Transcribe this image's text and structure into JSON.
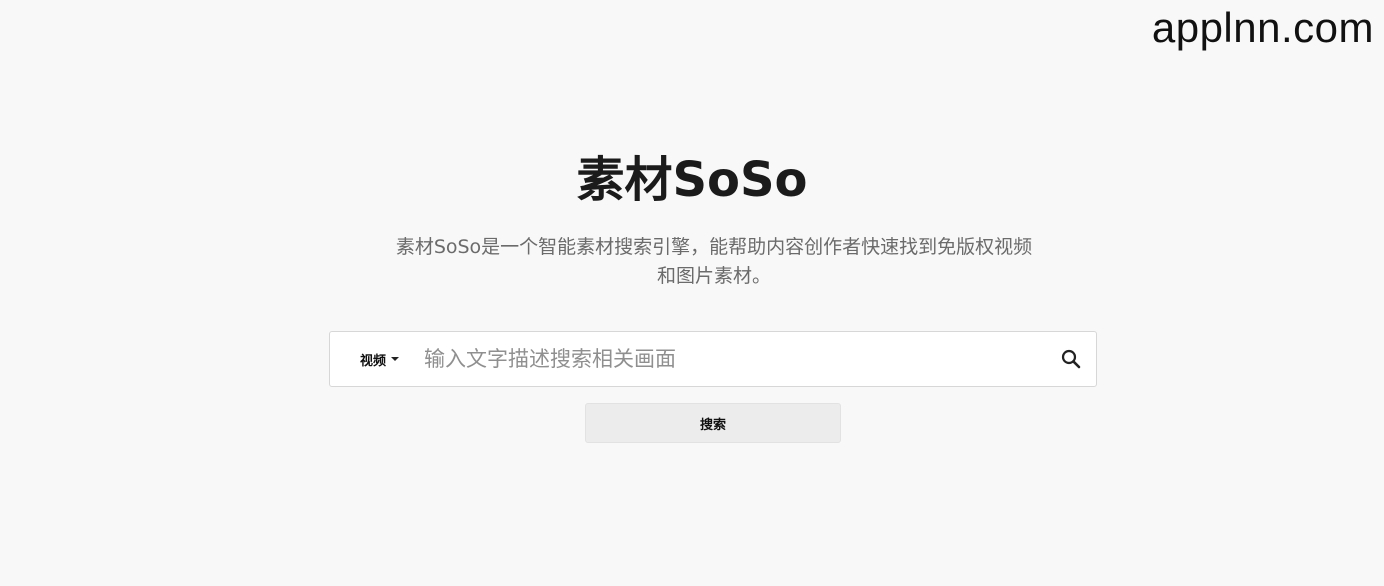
{
  "watermark": "applnn.com",
  "hero": {
    "title": "素材SoSo",
    "description_line1": "素材SoSo是一个智能素材搜索引擎，能帮助内容创作者快速找到免版权视频",
    "description_line2": "和图片素材。"
  },
  "search": {
    "type_selected": "视频",
    "placeholder": "输入文字描述搜索相关画面",
    "value": "",
    "button_label": "搜索"
  },
  "icons": {
    "search": "search-icon",
    "caret": "caret-down-icon"
  }
}
